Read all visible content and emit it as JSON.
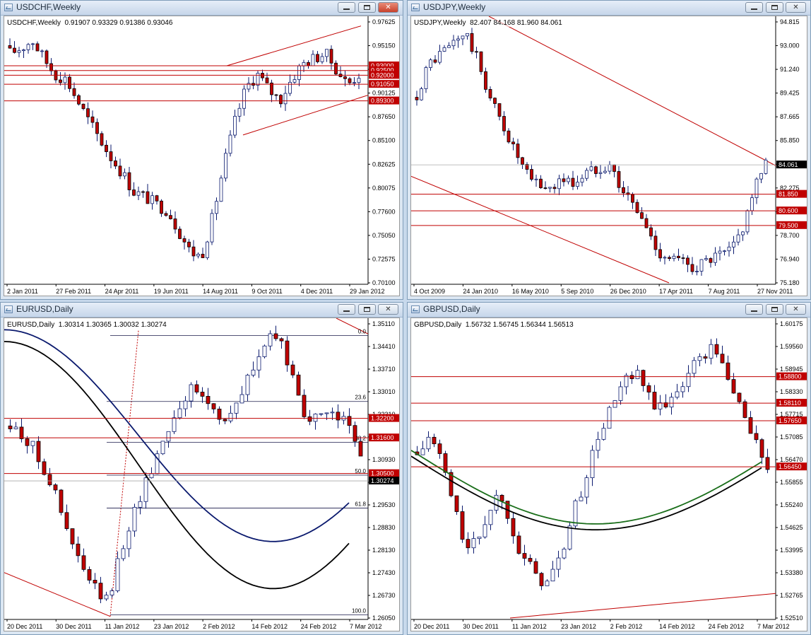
{
  "windows": [
    {
      "id": "usdchf",
      "title": "USDCHF,Weekly",
      "info": {
        "symbol": "USDCHF,Weekly",
        "ohlc": "0.91907 0.93329 0.91386 0.93046"
      },
      "price_scale": {
        "min": 0.701,
        "max": 0.97625,
        "ticks": [
          "0.97625",
          "0.95150",
          "0.92675",
          "0.90125",
          "0.87650",
          "0.85100",
          "0.82625",
          "0.80075",
          "0.77600",
          "0.75050",
          "0.72575",
          "0.70100"
        ]
      },
      "time_labels": [
        "2 Jan 2011",
        "27 Feb 2011",
        "24 Apr 2011",
        "19 Jun 2011",
        "14 Aug 2011",
        "9 Oct 2011",
        "4 Dec 2011",
        "29 Jan 2012"
      ],
      "levels": [
        {
          "label": "0.93000",
          "value": 0.93
        },
        {
          "label": "0.92500",
          "value": 0.925
        },
        {
          "label": "0.92000",
          "value": 0.92
        },
        {
          "label": "0.91050",
          "value": 0.9105
        },
        {
          "label": "0.89300",
          "value": 0.893
        }
      ],
      "colors": {
        "bull": "#ffffff",
        "bear": "#c00000",
        "line": "#c00000",
        "wick": "#0b1a6e"
      }
    },
    {
      "id": "usdjpy",
      "title": "USDJPY,Weekly",
      "info": {
        "symbol": "USDJPY,Weekly",
        "ohlc": "82.407 84.168 81.960 84.061"
      },
      "price_scale": {
        "min": 75.18,
        "max": 94.815,
        "ticks": [
          "94.815",
          "93.000",
          "91.240",
          "89.425",
          "87.665",
          "85.850",
          "84.090",
          "82.275",
          "80.515",
          "78.700",
          "76.940",
          "75.180"
        ]
      },
      "time_labels": [
        "4 Oct 2009",
        "24 Jan 2010",
        "16 May 2010",
        "5 Sep 2010",
        "26 Dec 2010",
        "17 Apr 2011",
        "7 Aug 2011",
        "27 Nov 2011"
      ],
      "levels": [
        {
          "label": "84.061",
          "value": 84.061,
          "current": true
        },
        {
          "label": "81.850",
          "value": 81.85
        },
        {
          "label": "80.600",
          "value": 80.6
        },
        {
          "label": "79.500",
          "value": 79.5
        }
      ],
      "colors": {
        "bull": "#ffffff",
        "bear": "#c00000",
        "line": "#c00000",
        "wick": "#0b1a6e"
      }
    },
    {
      "id": "eurusd",
      "title": "EURUSD,Daily",
      "info": {
        "symbol": "EURUSD,Daily",
        "ohlc": "1.30314 1.30365 1.30032 1.30274"
      },
      "price_scale": {
        "min": 1.2605,
        "max": 1.3511,
        "ticks": [
          "1.35110",
          "1.34410",
          "1.33710",
          "1.33010",
          "1.32310",
          "1.31610",
          "1.30930",
          "1.30230",
          "1.29530",
          "1.28830",
          "1.28130",
          "1.27430",
          "1.26730",
          "1.26050"
        ]
      },
      "time_labels": [
        "20 Dec 2011",
        "30 Dec 2011",
        "11 Jan 2012",
        "23 Jan 2012",
        "2 Feb 2012",
        "14 Feb 2012",
        "24 Feb 2012",
        "7 Mar 2012"
      ],
      "levels": [
        {
          "label": "1.32200",
          "value": 1.322
        },
        {
          "label": "1.31600",
          "value": 1.316
        },
        {
          "label": "1.30500",
          "value": 1.305
        },
        {
          "label": "1.30274",
          "value": 1.30274,
          "current": true
        }
      ],
      "fib_labels": [
        "0.0",
        "23.6",
        "38.2",
        "50.0",
        "61.8",
        "100.0"
      ],
      "colors": {
        "bull": "#ffffff",
        "bear": "#c00000",
        "line": "#c00000",
        "wick": "#0b1a6e",
        "ma_slow": "#0b1a6e",
        "ma_fast": "#000000"
      }
    },
    {
      "id": "gbpusd",
      "title": "GBPUSD,Daily",
      "info": {
        "symbol": "GBPUSD,Daily",
        "ohlc": "1.56732 1.56745 1.56344 1.56513"
      },
      "price_scale": {
        "min": 1.5251,
        "max": 1.60175,
        "ticks": [
          "1.60175",
          "1.59560",
          "1.58945",
          "1.58330",
          "1.57715",
          "1.57085",
          "1.56470",
          "1.55855",
          "1.55240",
          "1.54625",
          "1.53995",
          "1.53380",
          "1.52765",
          "1.52510"
        ]
      },
      "time_labels": [
        "20 Dec 2011",
        "30 Dec 2011",
        "11 Jan 2012",
        "23 Jan 2012",
        "2 Feb 2012",
        "14 Feb 2012",
        "24 Feb 2012",
        "7 Mar 2012"
      ],
      "levels": [
        {
          "label": "1.58800",
          "value": 1.588
        },
        {
          "label": "1.58110",
          "value": 1.5811
        },
        {
          "label": "1.57650",
          "value": 1.5765
        },
        {
          "label": "1.56450",
          "value": 1.5645
        }
      ],
      "colors": {
        "bull": "#ffffff",
        "bear": "#c00000",
        "line": "#c00000",
        "wick": "#0b1a6e",
        "ma_slow": "#1a6e1a",
        "ma_fast": "#000000"
      }
    }
  ]
}
